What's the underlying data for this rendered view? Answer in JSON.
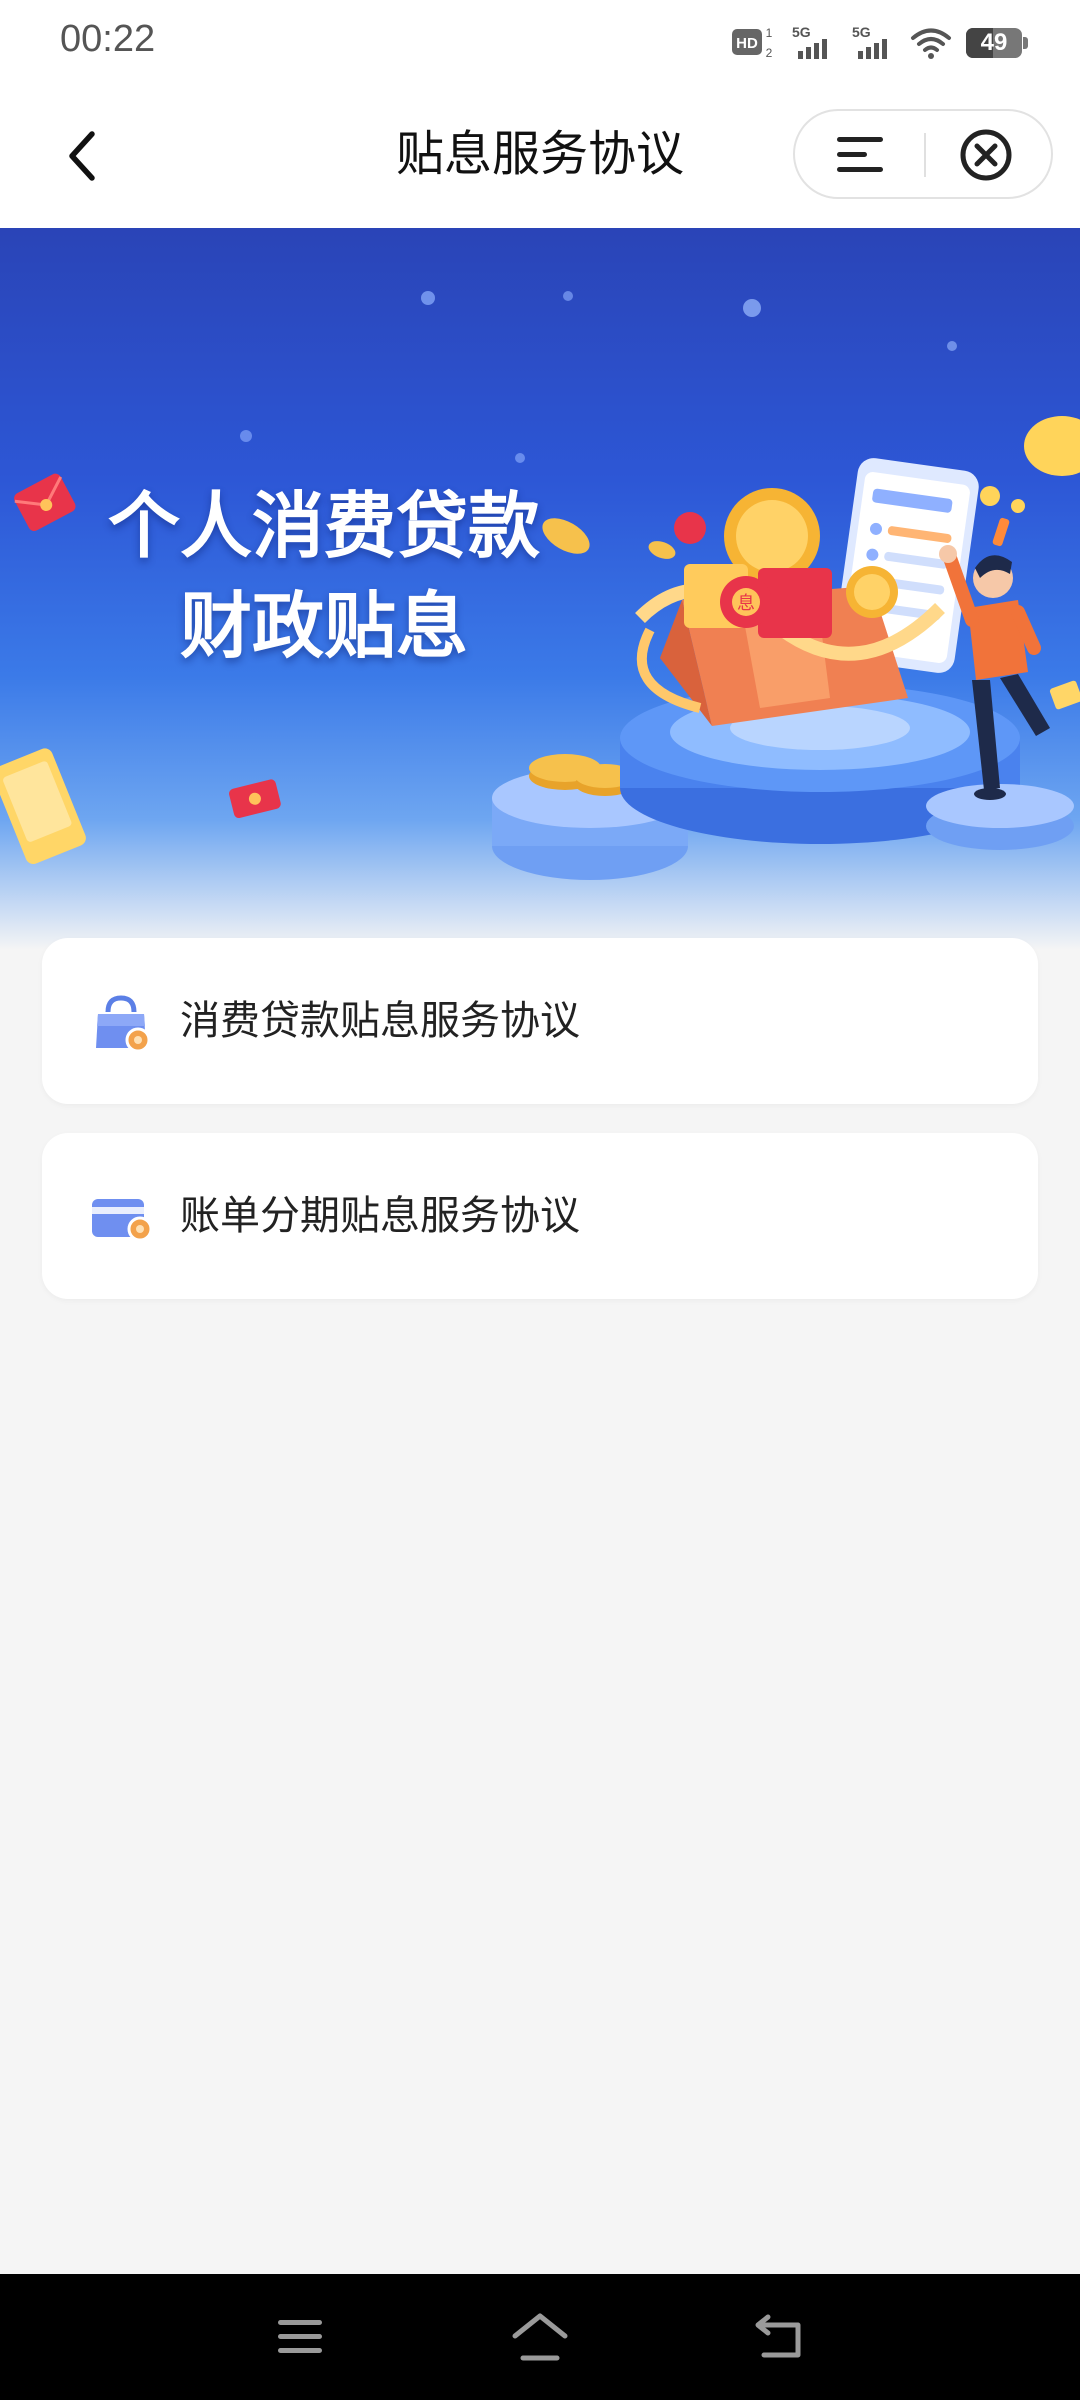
{
  "status_bar": {
    "time": "00:22",
    "battery_level": "49",
    "battery_fraction": 0.49,
    "network_1": "5G",
    "network_2": "5G",
    "hd_label": "HD",
    "hd_sub": "2",
    "hd_sup": "1"
  },
  "header": {
    "title": "贴息服务协议"
  },
  "banner": {
    "title_line1": "个人消费贷款",
    "title_line2": "财政贴息",
    "envelope_char": "息"
  },
  "agreements": [
    {
      "label": "消费贷款贴息服务协议",
      "icon": "shopping-bag-icon"
    },
    {
      "label": "账单分期贴息服务协议",
      "icon": "credit-card-icon"
    }
  ],
  "colors": {
    "banner_top": "#2a44b7",
    "banner_mid": "#3b7ae8",
    "accent_orange": "#f3a24b",
    "icon_blue": "#5b7fe6"
  }
}
